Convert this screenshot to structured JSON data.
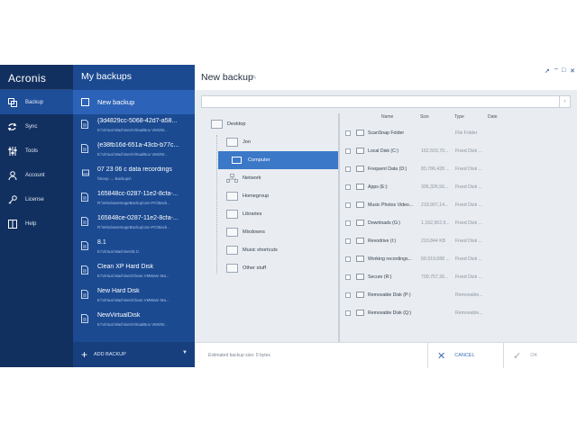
{
  "app": {
    "brand": "Acronis"
  },
  "nav": {
    "items": [
      {
        "label": "Backup",
        "icon": "copy-icon",
        "active": true
      },
      {
        "label": "Sync",
        "icon": "sync-icon",
        "active": false
      },
      {
        "label": "Tools",
        "icon": "tools-icon",
        "active": false
      },
      {
        "label": "Account",
        "icon": "account-icon",
        "active": false
      },
      {
        "label": "License",
        "icon": "key-icon",
        "active": false
      },
      {
        "label": "Help",
        "icon": "book-icon",
        "active": false
      }
    ]
  },
  "backups": {
    "title": "My backups",
    "new_backup": "New backup",
    "items": [
      {
        "name": "{3d4829cc-5068-42d7-a58...",
        "path": "E:\\Virtual Machines\\VirtualBox VMs\\W...",
        "icon": "file-icon"
      },
      {
        "name": "{e38fb16d-651a-43cb-b77c...",
        "path": "E:\\Virtual Machines\\VirtualBox VMs\\W...",
        "icon": "file-icon"
      },
      {
        "name": "07 23 06 c data recordings",
        "path": "\\\\Keep → Backups\\",
        "icon": "drive-icon"
      },
      {
        "name": "165848cc-0287-11e2-8cfa-...",
        "path": "R:\\WindowsImageBackup\\Jon-PC\\Back...",
        "icon": "file-icon"
      },
      {
        "name": "165848ce-0287-11e2-8cfa-...",
        "path": "R:\\WindowsImageBackup\\Jon-PC\\Back...",
        "icon": "file-icon"
      },
      {
        "name": "8.1",
        "path": "E:\\Virtual Machines\\8.1\\",
        "icon": "file-icon"
      },
      {
        "name": "Clean XP Hard Disk",
        "path": "E:\\Virtual Machines\\Clean VMWare Ma...",
        "icon": "file-icon"
      },
      {
        "name": "New Hard Disk",
        "path": "E:\\Virtual Machines\\Clean VMWare Ma...",
        "icon": "file-icon"
      },
      {
        "name": "NewVirtualDisk",
        "path": "E:\\Virtual Machines\\VirtualBox VMs\\W...",
        "icon": "file-icon"
      }
    ],
    "add_backup": "ADD BACKUP"
  },
  "main": {
    "title": "New backup",
    "window_controls": [
      "↗",
      "–",
      "□",
      "✕"
    ],
    "search_placeholder": "",
    "tree": [
      {
        "label": "Desktop",
        "level": 0,
        "icon": "folder-icon",
        "selected": false
      },
      {
        "label": "Jon",
        "level": 1,
        "icon": "folder-icon",
        "selected": false
      },
      {
        "label": "Computer",
        "level": 1,
        "icon": "monitor-icon",
        "selected": true
      },
      {
        "label": "Network",
        "level": 1,
        "icon": "network-icon",
        "selected": false
      },
      {
        "label": "Homegroup",
        "level": 1,
        "icon": "folder-icon",
        "selected": false
      },
      {
        "label": "Libraries",
        "level": 1,
        "icon": "folder-icon",
        "selected": false
      },
      {
        "label": "Mixdowns",
        "level": 1,
        "icon": "folder-icon",
        "selected": false
      },
      {
        "label": "Music shortcuts",
        "level": 1,
        "icon": "folder-icon",
        "selected": false
      },
      {
        "label": "Other stuff",
        "level": 1,
        "icon": "folder-icon",
        "selected": false
      }
    ],
    "columns": [
      "Name",
      "Size",
      "Type",
      "Date"
    ],
    "files": [
      {
        "name": "ScanSnap Folder",
        "size": "",
        "type": "File Folder"
      },
      {
        "name": "Local Disk (C:)",
        "size": "162,503,70...",
        "type": "Fixed Disk ..."
      },
      {
        "name": "Frequent Data (D:)",
        "size": "83,786,428 ...",
        "type": "Fixed Disk ..."
      },
      {
        "name": "Apps (E:)",
        "size": "306,326,56...",
        "type": "Fixed Disk ..."
      },
      {
        "name": "Music Photos Video...",
        "size": "219,907,14...",
        "type": "Fixed Disk ..."
      },
      {
        "name": "Downloads (G:)",
        "size": "1,162,962,9...",
        "type": "Fixed Disk ..."
      },
      {
        "name": "Revodrive (I:)",
        "size": "210,844 KB",
        "type": "Fixed Disk ..."
      },
      {
        "name": "Working recordings...",
        "size": "69,919,688 ...",
        "type": "Fixed Disk ..."
      },
      {
        "name": "Secure (R:)",
        "size": "709,757,26...",
        "type": "Fixed Disk ..."
      },
      {
        "name": "Removable Disk (P:)",
        "size": "",
        "type": "Removable..."
      },
      {
        "name": "Removable Disk (Q:)",
        "size": "",
        "type": "Removable..."
      }
    ],
    "estimated": "Estimated backup size:  0 bytes",
    "cancel": "CANCEL",
    "ok": "OK"
  }
}
